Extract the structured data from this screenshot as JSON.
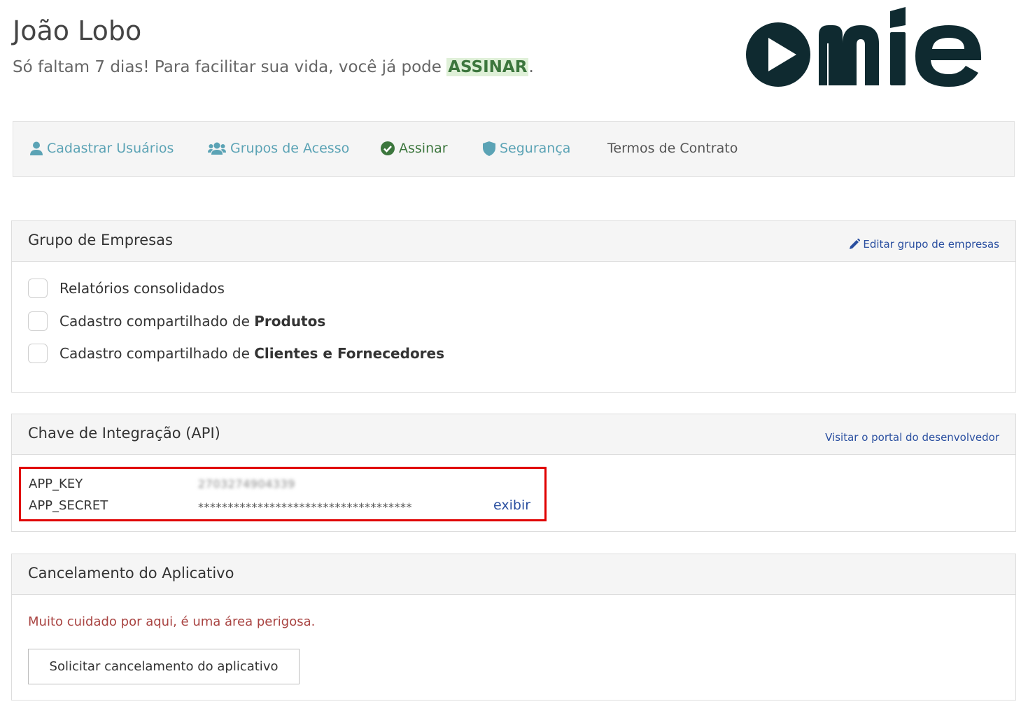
{
  "header": {
    "user_name": "João Lobo",
    "trial_text": "Só faltam 7 dias! Para facilitar sua vida, você já pode ",
    "trial_link": "ASSINAR",
    "trial_end": ".",
    "logo_text": "omie"
  },
  "nav": {
    "items": [
      {
        "label": "Cadastrar Usuários",
        "icon": "user-icon"
      },
      {
        "label": "Grupos de Acesso",
        "icon": "users-group-icon"
      },
      {
        "label": "Assinar",
        "icon": "check-circle-icon"
      },
      {
        "label": "Segurança",
        "icon": "shield-icon"
      },
      {
        "label": "Termos de Contrato",
        "icon": ""
      }
    ]
  },
  "group_panel": {
    "title": "Grupo de Empresas",
    "edit_link": "Editar grupo de empresas",
    "options": [
      {
        "text": "Relatórios consolidados",
        "bold": "",
        "checked": false
      },
      {
        "text": "Cadastro compartilhado de ",
        "bold": "Produtos",
        "checked": false
      },
      {
        "text": "Cadastro compartilhado de ",
        "bold": "Clientes e Fornecedores",
        "checked": false
      }
    ]
  },
  "api_panel": {
    "title": "Chave de Integração (API)",
    "portal_link": "Visitar o portal do desenvolvedor",
    "app_key_label": "APP_KEY",
    "app_key_value": "2703274904339",
    "app_secret_label": "APP_SECRET",
    "app_secret_value": "************************************",
    "show_link": "exibir"
  },
  "cancel_panel": {
    "title": "Cancelamento do Aplicativo",
    "warning": "Muito cuidado por aqui, é uma área perigosa.",
    "button": "Solicitar cancelamento do aplicativo"
  },
  "colors": {
    "link": "#2a4fa0",
    "nav_teal": "#5ba3b5",
    "success": "#3c763d",
    "danger": "#a94442",
    "highlight_border": "#e00000",
    "logo": "#0f2a30"
  }
}
